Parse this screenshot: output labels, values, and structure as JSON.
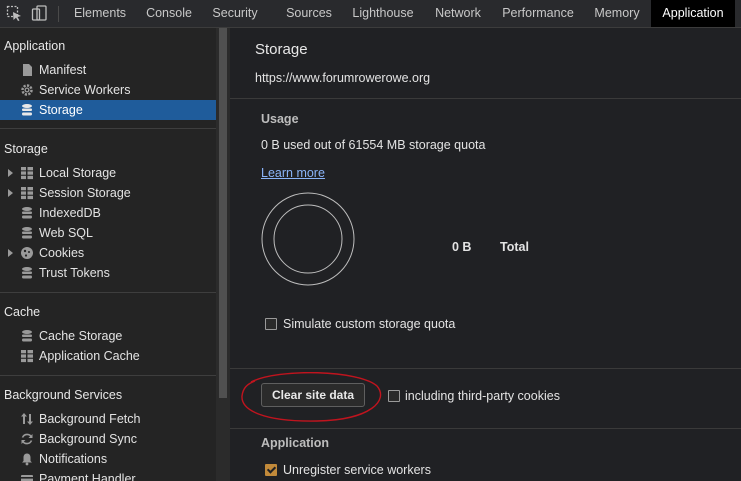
{
  "toolbar": {
    "tabs": [
      {
        "label": "Elements"
      },
      {
        "label": "Console"
      },
      {
        "label": "Security"
      },
      {
        "label": "Sources"
      },
      {
        "label": "Lighthouse"
      },
      {
        "label": "Network"
      },
      {
        "label": "Performance"
      },
      {
        "label": "Memory"
      },
      {
        "label": "Application",
        "active": true
      }
    ]
  },
  "sidebar": {
    "application": {
      "title": "Application",
      "items": [
        {
          "label": "Manifest",
          "icon": "file-icon"
        },
        {
          "label": "Service Workers",
          "icon": "gear-icon"
        },
        {
          "label": "Storage",
          "icon": "database-icon",
          "selected": true
        }
      ]
    },
    "storage": {
      "title": "Storage",
      "items": [
        {
          "label": "Local Storage",
          "icon": "grid-icon",
          "expandable": true
        },
        {
          "label": "Session Storage",
          "icon": "grid-icon",
          "expandable": true
        },
        {
          "label": "IndexedDB",
          "icon": "database-icon"
        },
        {
          "label": "Web SQL",
          "icon": "database-icon"
        },
        {
          "label": "Cookies",
          "icon": "cookie-icon",
          "expandable": true
        },
        {
          "label": "Trust Tokens",
          "icon": "database-icon"
        }
      ]
    },
    "cache": {
      "title": "Cache",
      "items": [
        {
          "label": "Cache Storage",
          "icon": "database-icon"
        },
        {
          "label": "Application Cache",
          "icon": "grid-icon"
        }
      ]
    },
    "background": {
      "title": "Background Services",
      "items": [
        {
          "label": "Background Fetch",
          "icon": "arrows-updown-icon"
        },
        {
          "label": "Background Sync",
          "icon": "sync-icon"
        },
        {
          "label": "Notifications",
          "icon": "bell-icon"
        },
        {
          "label": "Payment Handler",
          "icon": "card-icon"
        }
      ]
    }
  },
  "main": {
    "title": "Storage",
    "url": "https://www.forumrowerowe.org",
    "usage": {
      "heading": "Usage",
      "summary": "0 B used out of 61554 MB storage quota",
      "learn_more": "Learn more",
      "total_value": "0 B",
      "total_label": "Total",
      "simulate_label": "Simulate custom storage quota",
      "simulate_checked": false
    },
    "clear": {
      "button_label": "Clear site data",
      "third_party_label": "including third-party cookies",
      "third_party_checked": false
    },
    "application": {
      "heading": "Application",
      "unregister_label": "Unregister service workers",
      "unregister_checked": true
    }
  },
  "colors": {
    "selected": "#1f5c9b",
    "link": "#8ab4f8",
    "annotation": "#c0141e",
    "checkbox_on": "#c28a3a"
  }
}
